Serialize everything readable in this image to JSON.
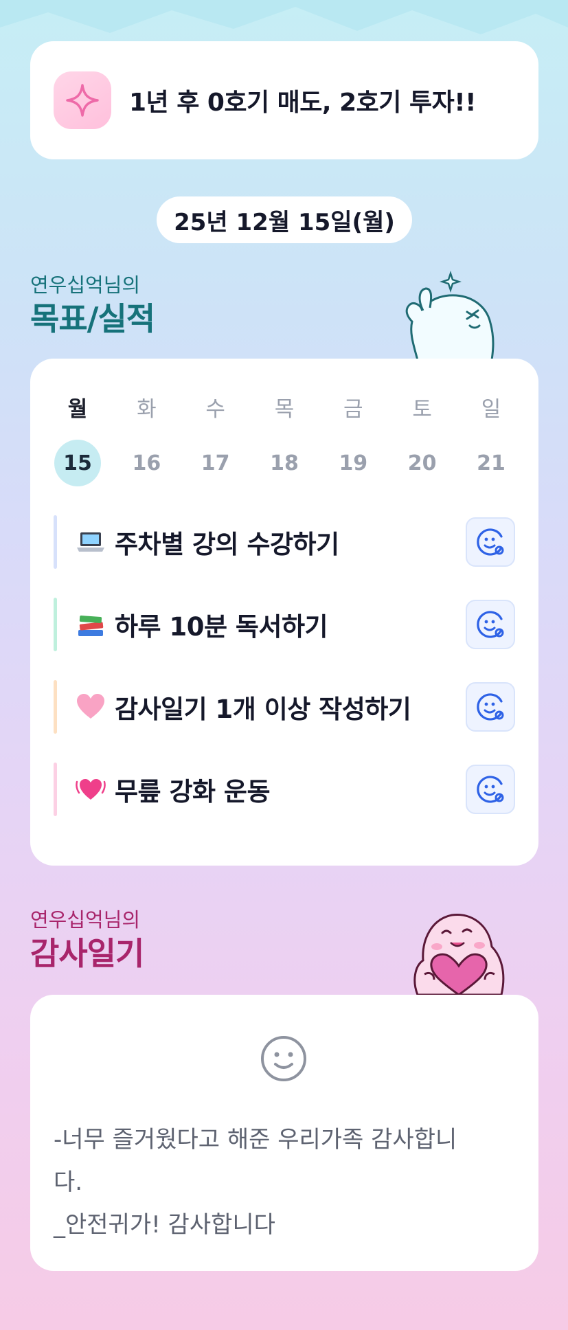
{
  "goal": {
    "text": "1년 후 0호기 매도, 2호기 투자!!",
    "icon": "sparkle-icon",
    "accent": "#f07ab0"
  },
  "date": "25년 12월 15일(월)",
  "goals_section": {
    "owner": "연우십억님의",
    "title": "목표/실적",
    "color": "#16727a"
  },
  "week": {
    "days": [
      {
        "name": "월",
        "num": "15",
        "active": true
      },
      {
        "name": "화",
        "num": "16"
      },
      {
        "name": "수",
        "num": "17"
      },
      {
        "name": "목",
        "num": "18"
      },
      {
        "name": "금",
        "num": "19"
      },
      {
        "name": "토",
        "num": "20"
      },
      {
        "name": "일",
        "num": "21"
      }
    ]
  },
  "tasks": [
    {
      "emoji": "laptop-icon",
      "label": "주차별 강의 수강하기",
      "bar_color": "#d7e1fb"
    },
    {
      "emoji": "books-icon",
      "label": "하루 10분 독서하기",
      "bar_color": "#bff0dd"
    },
    {
      "emoji": "pink-heart-icon",
      "label": "감사일기 1개 이상 작성하기",
      "bar_color": "#fde0c2"
    },
    {
      "emoji": "beating-heart-icon",
      "label": "무릎 강화 운동",
      "bar_color": "#fcd0e4"
    }
  ],
  "task_button_icon": "smile-face-icon",
  "diary_section": {
    "owner": "연우십억님의",
    "title": "감사일기",
    "color": "#a8256b"
  },
  "diary": {
    "mood_icon": "smile-face-icon",
    "text": "-너무 즐거웠다고 해준 우리가족 감사합니\n다.\n_안전귀가! 감사합니다"
  }
}
